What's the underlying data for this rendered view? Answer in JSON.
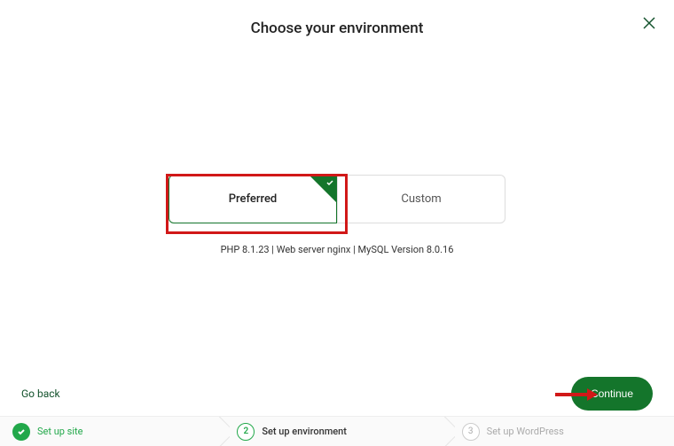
{
  "header": {
    "title": "Choose your environment"
  },
  "options": {
    "preferred": "Preferred",
    "custom": "Custom"
  },
  "tech_line": "PHP 8.1.23 | Web server nginx | MySQL Version 8.0.16",
  "actions": {
    "go_back": "Go back",
    "continue": "Continue"
  },
  "stepper": {
    "step1": {
      "label": "Set up site"
    },
    "step2": {
      "number": "2",
      "label": "Set up environment"
    },
    "step3": {
      "number": "3",
      "label": "Set up WordPress"
    }
  }
}
